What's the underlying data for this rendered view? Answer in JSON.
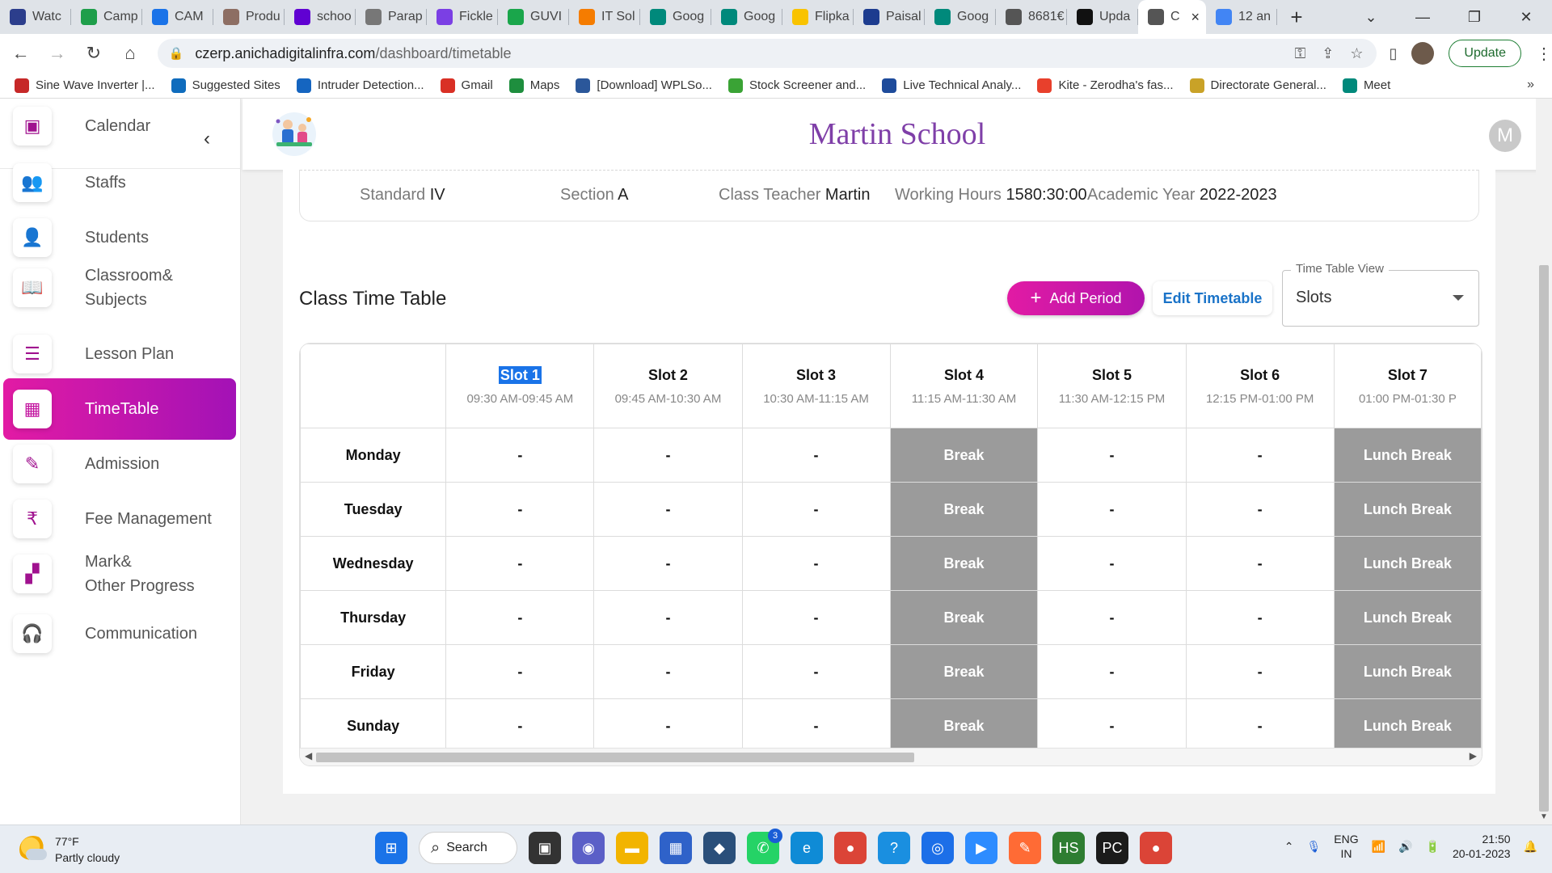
{
  "browser": {
    "tabs": [
      {
        "label": "Watc",
        "icon": "ph-favicon",
        "color": "#2c3e8c"
      },
      {
        "label": "Camp",
        "icon": "plus-favicon",
        "color": "#1e9e4a"
      },
      {
        "label": "CAM",
        "icon": "diamond-favicon",
        "color": "#1a73e8"
      },
      {
        "label": "Produ",
        "icon": "person-favicon",
        "color": "#8d6e63"
      },
      {
        "label": "schoo",
        "icon": "y-favicon",
        "color": "#6001d2"
      },
      {
        "label": "Parap",
        "icon": "pencil-favicon",
        "color": "#777777"
      },
      {
        "label": "Fickle",
        "icon": "wave-favicon",
        "color": "#7b3fe4"
      },
      {
        "label": "GUVI",
        "icon": "g-favicon",
        "color": "#1aa64b"
      },
      {
        "label": "IT Sol",
        "icon": "rdx-favicon",
        "color": "#f57c00"
      },
      {
        "label": "Goog",
        "icon": "meet-favicon",
        "color": "#00897b"
      },
      {
        "label": "Goog",
        "icon": "meet-favicon",
        "color": "#00897b"
      },
      {
        "label": "Flipka",
        "icon": "flipkart-favicon",
        "color": "#f9c300"
      },
      {
        "label": "Paisal",
        "icon": "pb-favicon",
        "color": "#1d3c8f"
      },
      {
        "label": "Goog",
        "icon": "meet-favicon",
        "color": "#00897b"
      },
      {
        "label": "8681€",
        "icon": "globe-favicon",
        "color": "#555555"
      },
      {
        "label": "Upda",
        "icon": "f-favicon",
        "color": "#111111"
      },
      {
        "label": "C",
        "icon": "globe-favicon",
        "color": "#555555",
        "active": true
      },
      {
        "label": "12 an",
        "icon": "google-favicon",
        "color": "#4285f4"
      }
    ],
    "new_tab_symbol": "+",
    "close_symbol": "×",
    "url_host": "czerp.anichadigitalinfra.com",
    "url_path": "/dashboard/timetable",
    "update_label": "Update",
    "bookmarks": [
      {
        "label": "Sine Wave Inverter |...",
        "icon": "sigma-favicon",
        "color": "#c62828"
      },
      {
        "label": "Suggested Sites",
        "icon": "bing-favicon",
        "color": "#0f6cbd"
      },
      {
        "label": "Intruder Detection...",
        "icon": "bl-favicon",
        "color": "#1565c0"
      },
      {
        "label": "Gmail",
        "icon": "gmail-favicon",
        "color": "#d93025"
      },
      {
        "label": "Maps",
        "icon": "maps-pin-favicon",
        "color": "#1e8e3e"
      },
      {
        "label": "[Download] WPLSo...",
        "icon": "gear-favicon",
        "color": "#2b579a"
      },
      {
        "label": "Stock Screener and...",
        "icon": "bars-favicon",
        "color": "#3aa335"
      },
      {
        "label": "Live Technical Analy...",
        "icon": "ci-favicon",
        "color": "#1e4b9b"
      },
      {
        "label": "Kite - Zerodha's fas...",
        "icon": "kite-favicon",
        "color": "#e8402c"
      },
      {
        "label": "Directorate General...",
        "icon": "emblem-favicon",
        "color": "#c9a227"
      },
      {
        "label": "Meet",
        "icon": "meet-favicon",
        "color": "#00897b"
      }
    ],
    "bookmarks_more": "»"
  },
  "app": {
    "school_name": "Martin School",
    "avatar_letter": "M",
    "collapse_icon": "‹",
    "nav": [
      {
        "label": "Calendar",
        "icon": "calendar-icon",
        "glyph": "▣"
      },
      {
        "label": "Staffs",
        "icon": "people-icon",
        "glyph": "👥"
      },
      {
        "label": "Students",
        "icon": "add-person-icon",
        "glyph": "👤"
      },
      {
        "label": "Classroom&",
        "label2": "Subjects",
        "icon": "book-icon",
        "glyph": "📖"
      },
      {
        "label": "Lesson Plan",
        "icon": "list-icon",
        "glyph": "☰"
      },
      {
        "label": "TimeTable",
        "icon": "table-icon",
        "glyph": "▦",
        "active": true
      },
      {
        "label": "Admission",
        "icon": "note-add-icon",
        "glyph": "✎"
      },
      {
        "label": "Fee Management",
        "icon": "rupee-icon",
        "glyph": "₹"
      },
      {
        "label": "Mark&",
        "label2": "Other Progress",
        "icon": "grid-icon",
        "glyph": "▞"
      },
      {
        "label": "Communication",
        "icon": "headset-icon",
        "glyph": "🎧"
      }
    ],
    "class_info": {
      "standard_label": "Standard",
      "standard": "IV",
      "section_label": "Section",
      "section": "A",
      "teacher_label": "Class Teacher",
      "teacher": "Martin",
      "hours_label": "Working Hours",
      "hours": "1580:30:00",
      "year_label": "Academic Year",
      "year": "2022-2023"
    },
    "timetable_title": "Class Time Table",
    "add_period_label": "Add Period",
    "edit_timetable_label": "Edit Timetable",
    "view_select": {
      "legend": "Time Table View",
      "value": "Slots"
    },
    "slots": [
      {
        "name": "Slot 1",
        "time": "09:30 AM-09:45 AM",
        "selected": true
      },
      {
        "name": "Slot 2",
        "time": "09:45 AM-10:30 AM"
      },
      {
        "name": "Slot 3",
        "time": "10:30 AM-11:15 AM"
      },
      {
        "name": "Slot 4",
        "time": "11:15 AM-11:30 AM"
      },
      {
        "name": "Slot 5",
        "time": "11:30 AM-12:15 PM"
      },
      {
        "name": "Slot 6",
        "time": "12:15 PM-01:00 PM"
      },
      {
        "name": "Slot 7",
        "time": "01:00 PM-01:30 P"
      }
    ],
    "rows": [
      {
        "day": "Monday",
        "cells": [
          "-",
          "-",
          "-",
          "Break",
          "-",
          "-",
          "Lunch Break"
        ]
      },
      {
        "day": "Tuesday",
        "cells": [
          "-",
          "-",
          "-",
          "Break",
          "-",
          "-",
          "Lunch Break"
        ]
      },
      {
        "day": "Wednesday",
        "cells": [
          "-",
          "-",
          "-",
          "Break",
          "-",
          "-",
          "Lunch Break"
        ]
      },
      {
        "day": "Thursday",
        "cells": [
          "-",
          "-",
          "-",
          "Break",
          "-",
          "-",
          "Lunch Break"
        ]
      },
      {
        "day": "Friday",
        "cells": [
          "-",
          "-",
          "-",
          "Break",
          "-",
          "-",
          "Lunch Break"
        ]
      },
      {
        "day": "Sunday",
        "cells": [
          "-",
          "-",
          "-",
          "Break",
          "-",
          "-",
          "Lunch Break"
        ]
      }
    ],
    "break_color": "#9b9b9b",
    "accent_gradient": [
      "#e21ba4",
      "#a312b6"
    ]
  },
  "taskbar": {
    "weather_temp": "77°F",
    "weather_desc": "Partly cloudy",
    "search_label": "Search",
    "apps": [
      {
        "name": "windows-start-icon",
        "color": "#1a73e8",
        "glyph": "⊞"
      },
      {
        "name": "task-view-icon",
        "color": "#333333",
        "glyph": "▣"
      },
      {
        "name": "teams-chat-icon",
        "color": "#5b5fc7",
        "glyph": "◉"
      },
      {
        "name": "file-explorer-icon",
        "color": "#f2b400",
        "glyph": "▬"
      },
      {
        "name": "store-icon",
        "color": "#2f62c9",
        "glyph": "▦"
      },
      {
        "name": "dbeaver-icon",
        "color": "#2a4f7a",
        "glyph": "◆"
      },
      {
        "name": "whatsapp-icon",
        "color": "#25d366",
        "glyph": "✆",
        "badge": "3"
      },
      {
        "name": "edge-icon",
        "color": "#0f8bd6",
        "glyph": "e"
      },
      {
        "name": "chrome-icon",
        "color": "#db4437",
        "glyph": "●"
      },
      {
        "name": "help-icon",
        "color": "#1a8fe0",
        "glyph": "?"
      },
      {
        "name": "signal-icon",
        "color": "#1c6fe8",
        "glyph": "◎"
      },
      {
        "name": "zoom-icon",
        "color": "#2d8cff",
        "glyph": "▶"
      },
      {
        "name": "brush-icon",
        "color": "#ff6b35",
        "glyph": "✎"
      },
      {
        "name": "hubstaff-icon",
        "color": "#2e7d32",
        "glyph": "HS"
      },
      {
        "name": "pycharm-icon",
        "color": "#1b1b1b",
        "glyph": "PC"
      },
      {
        "name": "chrome-alt-icon",
        "color": "#db4437",
        "glyph": "●"
      }
    ],
    "lang_line1": "ENG",
    "lang_line2": "IN",
    "time": "21:50",
    "date": "20-01-2023"
  }
}
